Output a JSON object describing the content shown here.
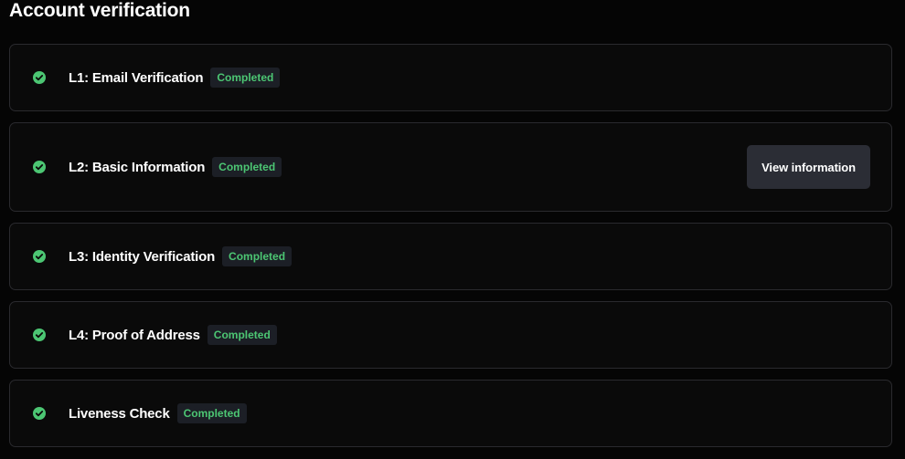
{
  "page": {
    "title": "Account verification"
  },
  "levels": [
    {
      "title": "L1: Email Verification",
      "status": "Completed",
      "status_icon": "check-circle-icon"
    },
    {
      "title": "L2: Basic Information",
      "status": "Completed",
      "status_icon": "check-circle-icon",
      "action_label": "View information"
    },
    {
      "title": "L3: Identity Verification",
      "status": "Completed",
      "status_icon": "check-circle-icon"
    },
    {
      "title": "L4: Proof of Address",
      "status": "Completed",
      "status_icon": "check-circle-icon"
    },
    {
      "title": "Liveness Check",
      "status": "Completed",
      "status_icon": "check-circle-icon"
    }
  ],
  "colors": {
    "background": "#050505",
    "card_border": "#2a2a2e",
    "success": "#4cc673",
    "badge_background": "#1c1f26",
    "button_background": "#2b2d35"
  }
}
